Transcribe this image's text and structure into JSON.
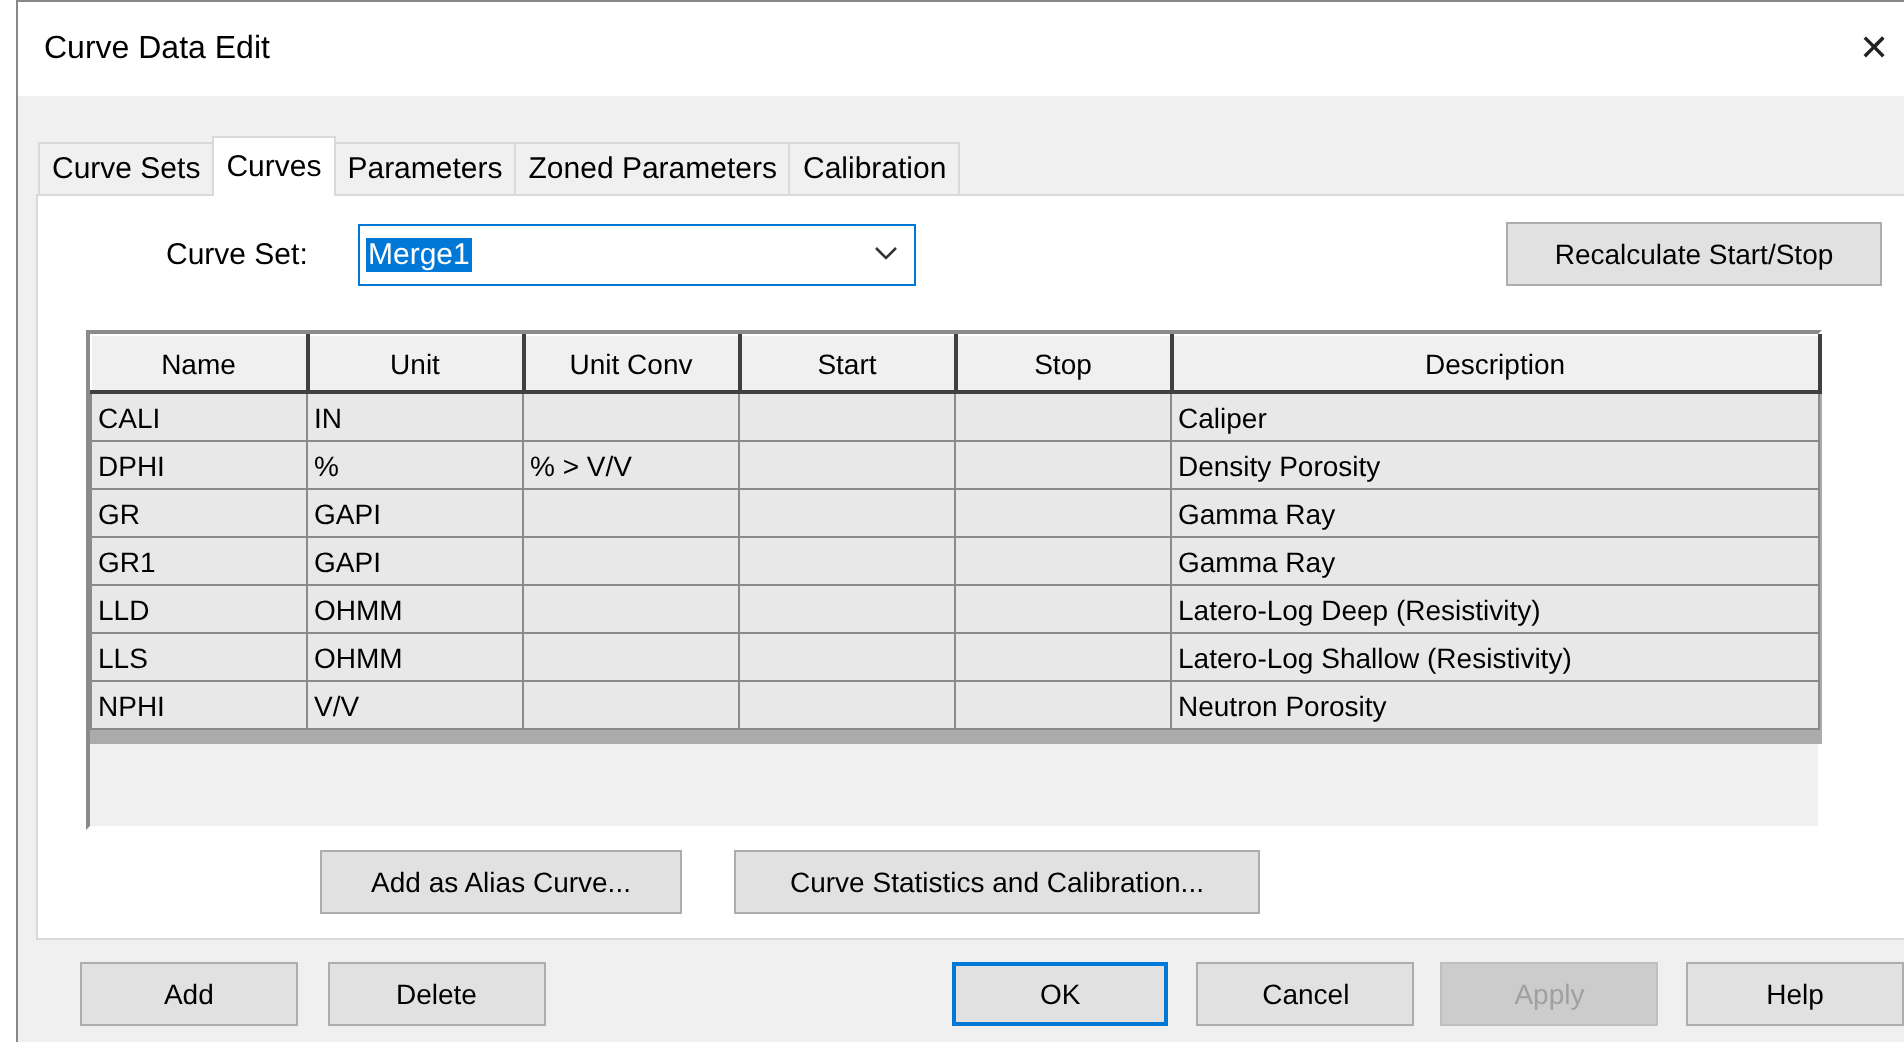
{
  "window": {
    "title": "Curve Data Edit",
    "close": "✕"
  },
  "tabs": [
    {
      "label": "Curve Sets",
      "selected": false
    },
    {
      "label": "Curves",
      "selected": true
    },
    {
      "label": "Parameters",
      "selected": false
    },
    {
      "label": "Zoned Parameters",
      "selected": false
    },
    {
      "label": "Calibration",
      "selected": false
    }
  ],
  "curve_set": {
    "label": "Curve Set:",
    "value": "Merge1",
    "selected_text": true
  },
  "recalculate_button": "Recalculate Start/Stop",
  "table": {
    "columns": [
      "Name",
      "Unit",
      "Unit Conv",
      "Start",
      "Stop",
      "Description"
    ],
    "rows": [
      [
        "CALI",
        "IN",
        "",
        "",
        "",
        "Caliper"
      ],
      [
        "DPHI",
        "%",
        "% > V/V",
        "",
        "",
        "Density Porosity"
      ],
      [
        "GR",
        "GAPI",
        "",
        "",
        "",
        "Gamma Ray"
      ],
      [
        "GR1",
        "GAPI",
        "",
        "",
        "",
        "Gamma Ray"
      ],
      [
        "LLD",
        "OHMM",
        "",
        "",
        "",
        "Latero-Log Deep (Resistivity)"
      ],
      [
        "LLS",
        "OHMM",
        "",
        "",
        "",
        "Latero-Log Shallow (Resistivity)"
      ],
      [
        "NPHI",
        "V/V",
        "",
        "",
        "",
        "Neutron Porosity"
      ]
    ]
  },
  "panel_buttons": [
    "Add as Alias Curve...",
    "Curve Statistics and Calibration..."
  ],
  "buttons": [
    {
      "label": "Add",
      "default": false,
      "disabled": false
    },
    {
      "label": "Delete",
      "default": false,
      "disabled": false
    },
    {
      "label": "OK",
      "default": true,
      "disabled": false
    },
    {
      "label": "Cancel",
      "default": false,
      "disabled": false
    },
    {
      "label": "Apply",
      "default": false,
      "disabled": true
    },
    {
      "label": "Help",
      "default": false,
      "disabled": false
    }
  ]
}
